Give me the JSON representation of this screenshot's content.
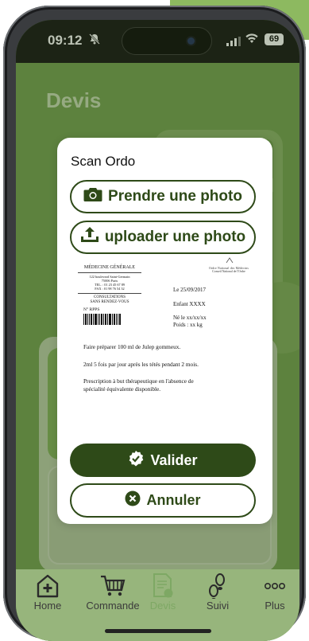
{
  "status_bar": {
    "time": "09:12",
    "battery": "69"
  },
  "page": {
    "title": "Devis"
  },
  "modal": {
    "title": "Scan Ordo",
    "photo_button": "Prendre une photo",
    "upload_button": "uploader une photo",
    "validate_button": "Valider",
    "cancel_button": "Annuler"
  },
  "prescription": {
    "header_left": "MÉDECINE GÉNÉRALE",
    "header_right_1": "Ordre National des Médecins",
    "header_right_2": "Conseil National de l'Ordre",
    "address_1": "122 boulevard Saint-Germain",
    "address_2": "75006 Paris",
    "tel": "TEL. : 01 23 45 67 89",
    "fax": "FAX : 01 98 76 54 32",
    "consult_1": "CONSULTATIONS",
    "consult_2": "SANS RENDEZ-VOUS",
    "rpps": "N° RPPS",
    "date": "Le 25/09/2017",
    "patient": "Enfant XXXX",
    "born": "Né le xx/xx/xx",
    "weight": "Poids : xx kg",
    "line1": "Faire préparer 100 ml de Julep gommeux.",
    "line2": "2ml 5 fois par jour après les tétés pendant 2 mois.",
    "line3a": "Prescription à but thérapeutique en l'absence de",
    "line3b": "spécialité équivalente disponible."
  },
  "tabs": [
    {
      "label": "Home",
      "icon": "home-plus-icon"
    },
    {
      "label": "Commande",
      "icon": "cart-icon"
    },
    {
      "label": "Devis",
      "icon": "document-icon"
    },
    {
      "label": "Suivi",
      "icon": "footprints-icon"
    },
    {
      "label": "Plus",
      "icon": "more-icon"
    }
  ],
  "colors": {
    "brand_dark": "#2e4a18",
    "app_green": "#6f9d4a",
    "active_tab": "#7ea864"
  }
}
